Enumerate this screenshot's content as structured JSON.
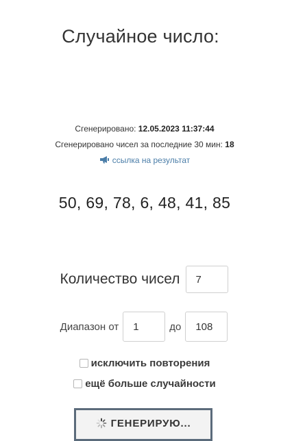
{
  "title": "Случайное число:",
  "meta": {
    "generated_label": "Сгенерировано:",
    "generated_value": "12.05.2023 11:37:44",
    "count_label": "Сгенерировано чисел за последние 30 мин:",
    "count_value": "18",
    "link_icon": "megaphone-icon",
    "link_text": "ссылка на результат"
  },
  "result": "50, 69, 78, 6, 48, 41, 85",
  "form": {
    "count_label": "Количество чисел",
    "count_value": "7",
    "range_from_label": "Диапазон от",
    "range_from_value": "1",
    "range_to_label": "до",
    "range_to_value": "108",
    "exclude_repeats_label": "исключить повторения",
    "exclude_repeats_checked": false,
    "more_random_label": "ещё больше случайности",
    "more_random_checked": false
  },
  "button": {
    "label": "ГЕНЕРИРУЮ...",
    "icon": "spinner-icon"
  },
  "colors": {
    "link": "#4a7da8",
    "button_border": "#5b6b7b",
    "button_bg": "#f3f3f3"
  }
}
